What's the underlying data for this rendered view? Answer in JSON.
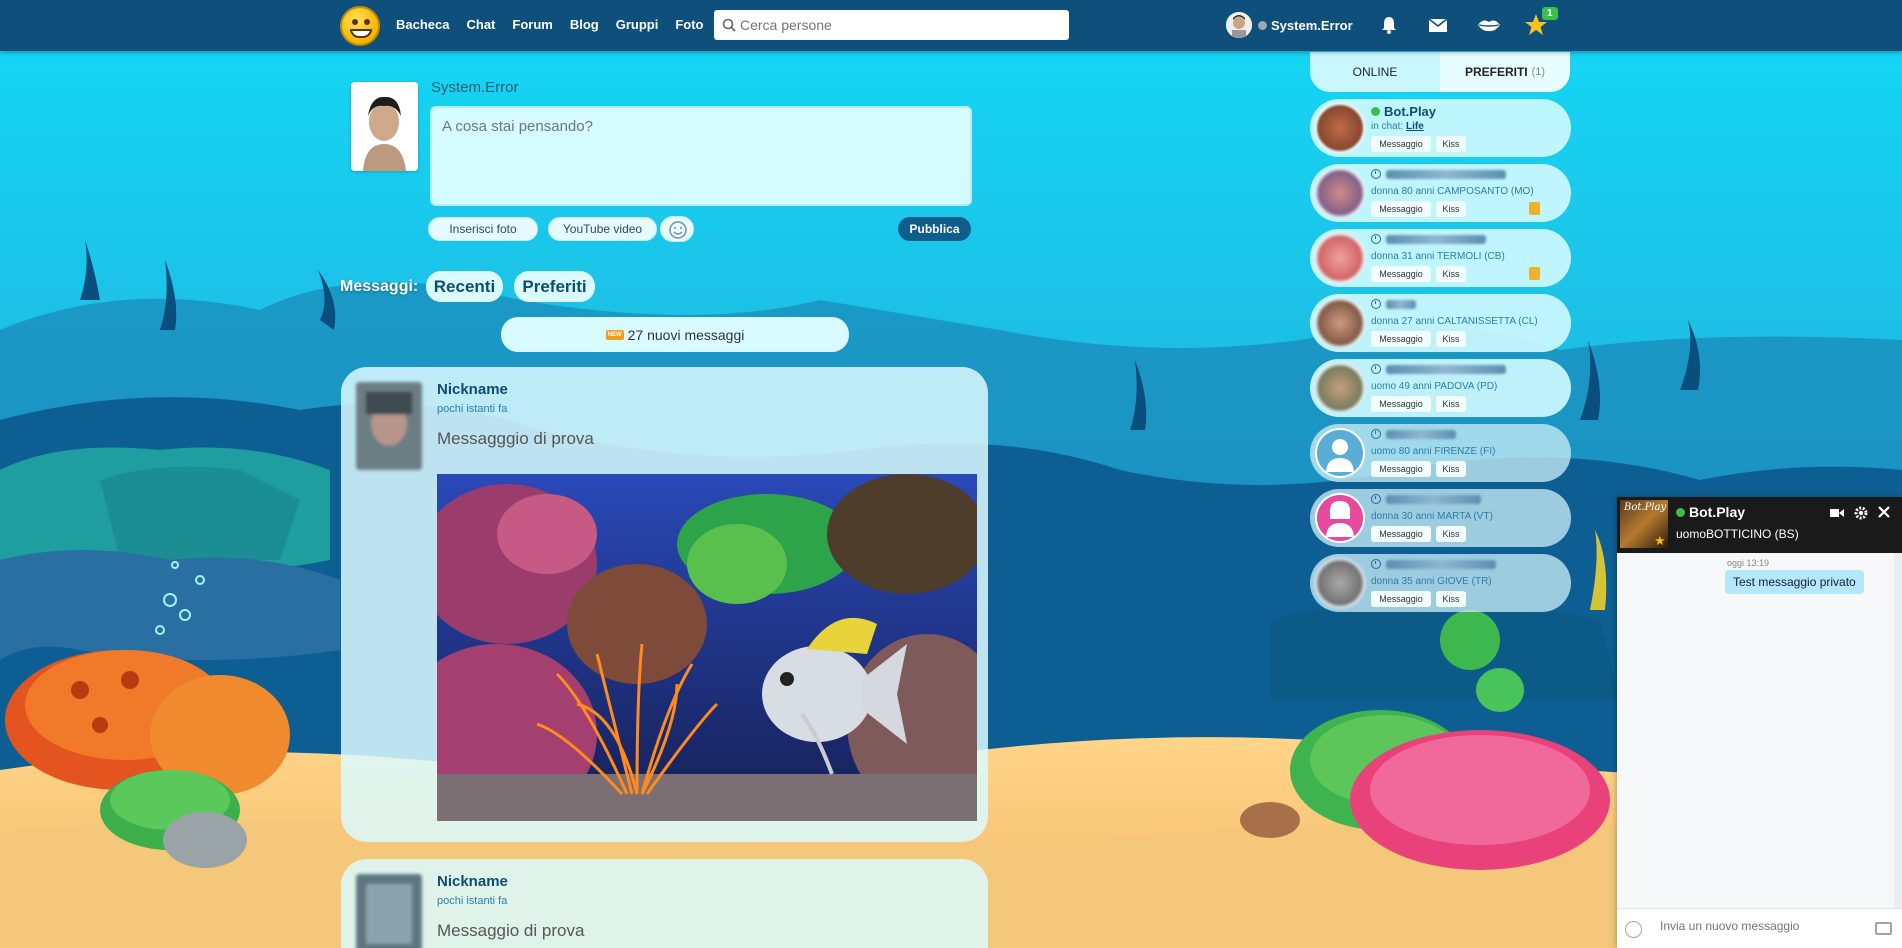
{
  "nav": {
    "items": [
      "Bacheca",
      "Chat",
      "Forum",
      "Blog",
      "Gruppi",
      "Foto"
    ],
    "search_placeholder": "Cerca persone",
    "username": "System.Error",
    "stars_badge": "1"
  },
  "composer": {
    "name": "System.Error",
    "placeholder": "A cosa stai pensando?",
    "photo_label": "Inserisci foto",
    "youtube_label": "YouTube video",
    "publish_label": "Pubblica"
  },
  "messages": {
    "label": "Messaggi:",
    "tab_recent": "Recenti",
    "tab_favorites": "Preferiti",
    "new_badge": "NEW",
    "new_count_text": "27 nuovi messaggi"
  },
  "posts": [
    {
      "name": "Nickname",
      "time": "pochi istanti fa",
      "text": "Messagggio di prova"
    },
    {
      "name": "Nickname",
      "time": "pochi istanti fa",
      "text": "Messaggio di prova"
    }
  ],
  "sidebar": {
    "tab_online": "ONLINE",
    "tab_favorites": "PREFERITI",
    "favorites_count": "(1)",
    "msg_btn": "Messaggio",
    "kiss_btn": "Kiss",
    "first": {
      "name": "Bot.Play",
      "status_prefix": "in chat:",
      "room": "Life"
    },
    "people": [
      "donna 80 anni CAMPOSANTO (MO)",
      "donna 31 anni TERMOLI (CB)",
      "donna 27 anni CALTANISSETTA (CL)",
      "uomo 49 anni PADOVA (PD)",
      "uomo 80 anni FIRENZE (FI)",
      "donna 30 anni MARTA (VT)",
      "donna 35 anni GIOVE (TR)"
    ]
  },
  "chat": {
    "avatar_text": "Bot.Play",
    "name": "Bot.Play",
    "subtitle": "uomoBOTTICINO (BS)",
    "time": "oggi 13:19",
    "message": "Test messaggio privato",
    "input_placeholder": "Invia un nuovo messaggio"
  }
}
